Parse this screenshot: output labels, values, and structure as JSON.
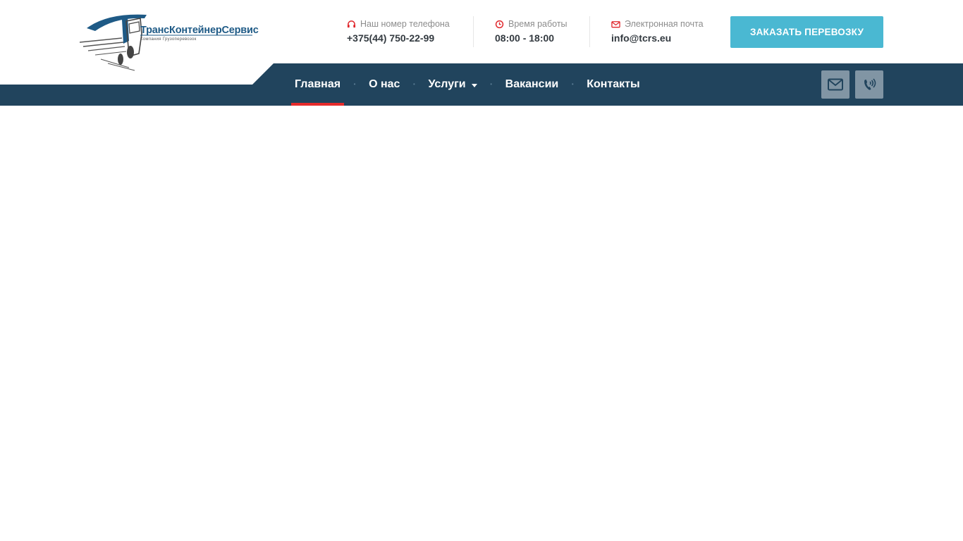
{
  "logo": {
    "name": "ТрансКонтейнерСервис",
    "tagline": "Компания Грузоперевозок"
  },
  "contacts": {
    "phone": {
      "label": "Наш номер телефона",
      "value": "+375(44) 750-22-99",
      "icon": "headphones-icon"
    },
    "hours": {
      "label": "Время работы",
      "value": "08:00 - 18:00",
      "icon": "clock-icon"
    },
    "email": {
      "label": "Электронная почта",
      "value": "info@tcrs.eu",
      "icon": "envelope-icon"
    }
  },
  "order_button": {
    "label": "ЗАКАЗАТЬ ПЕРЕВОЗКУ"
  },
  "nav": {
    "items": [
      {
        "label": "Главная",
        "active": true
      },
      {
        "label": "О нас"
      },
      {
        "label": "Услуги",
        "dropdown": true
      },
      {
        "label": "Вакансии"
      },
      {
        "label": "Контакты"
      }
    ],
    "separator": "•",
    "icon_buttons": [
      "envelope-icon",
      "phone-volume-icon"
    ]
  },
  "colors": {
    "nav_background": "#21445d",
    "accent_button": "#4ab8d2",
    "active_underline": "#e52b2b",
    "icon_red": "#e0262b",
    "logo_blue": "#1e5a86"
  }
}
